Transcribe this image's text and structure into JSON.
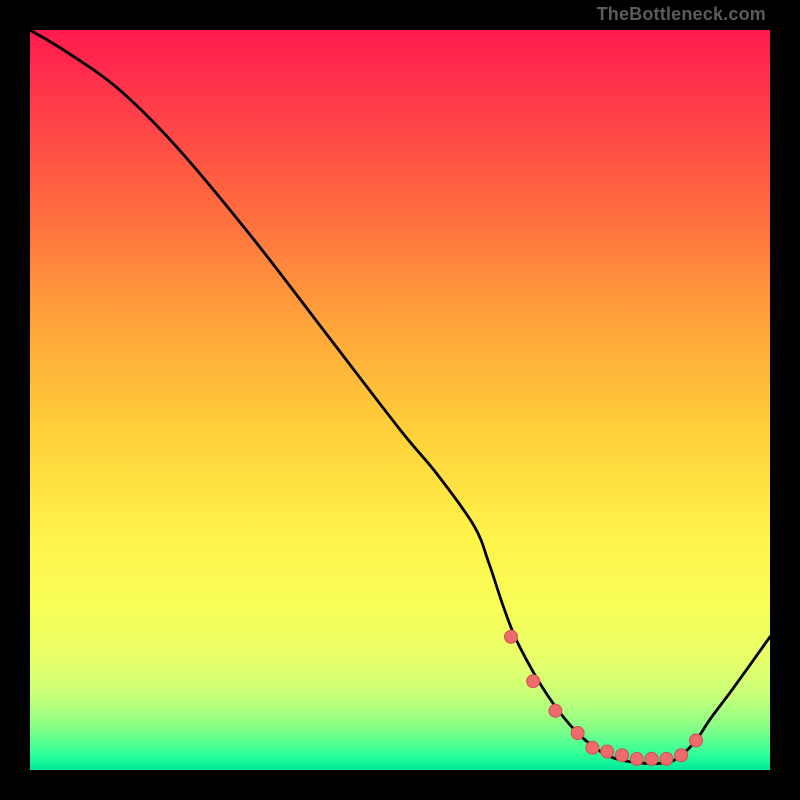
{
  "watermark": "TheBottleneck.com",
  "colors": {
    "gradient_top": "#ff1a4d",
    "gradient_mid": "#fff24a",
    "gradient_bottom": "#00e89a",
    "line": "#000000",
    "dot_fill": "#ef6a6a",
    "dot_stroke": "#cf5252",
    "frame": "#000000"
  },
  "chart_data": {
    "type": "line",
    "title": "",
    "xlabel": "",
    "ylabel": "",
    "xlim": [
      0,
      100
    ],
    "ylim": [
      0,
      100
    ],
    "grid": false,
    "legend": false,
    "series": [
      {
        "name": "curve",
        "x": [
          0,
          5,
          12,
          20,
          30,
          40,
          50,
          55,
          60,
          62,
          64,
          66,
          70,
          74,
          78,
          82,
          86,
          88,
          90,
          92,
          95,
          100
        ],
        "values": [
          100,
          97,
          92,
          84,
          72,
          59,
          46,
          40,
          33,
          28,
          22,
          17,
          10,
          5,
          2,
          1,
          1,
          2,
          4,
          7,
          11,
          18
        ]
      }
    ],
    "markers": {
      "name": "highlight-dots",
      "x": [
        65,
        68,
        71,
        74,
        76,
        78,
        80,
        82,
        84,
        86,
        88,
        90
      ],
      "values": [
        18,
        12,
        8,
        5,
        3,
        2.5,
        2,
        1.5,
        1.5,
        1.5,
        2,
        4
      ]
    }
  }
}
